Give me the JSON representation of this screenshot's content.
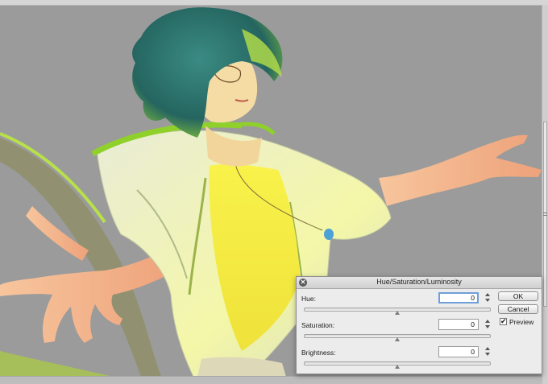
{
  "dialog": {
    "title": "Hue/Saturation/Luminosity",
    "close_glyph": "✕",
    "hue": {
      "label": "Hue:",
      "value": "0",
      "slider": 0.5
    },
    "saturation": {
      "label": "Saturation:",
      "value": "0",
      "slider": 0.5
    },
    "brightness": {
      "label": "Brightness:",
      "value": "0",
      "slider": 0.5
    },
    "ok_label": "OK",
    "cancel_label": "Cancel",
    "preview_label": "Preview",
    "preview_checked": true,
    "check_glyph": "✔"
  },
  "colors": {
    "canvas_bg": "#9b9b9b",
    "hair": "#2c6f6c",
    "jacket_green": "#8fd12a",
    "shirt_yellow": "#f6ee3c",
    "skin": "#f2b48a",
    "focus_blue": "#6f9fd8"
  },
  "icons": {
    "close": "close-icon",
    "spinner": "spinner-arrows-icon",
    "checkbox": "checkmark-icon"
  }
}
